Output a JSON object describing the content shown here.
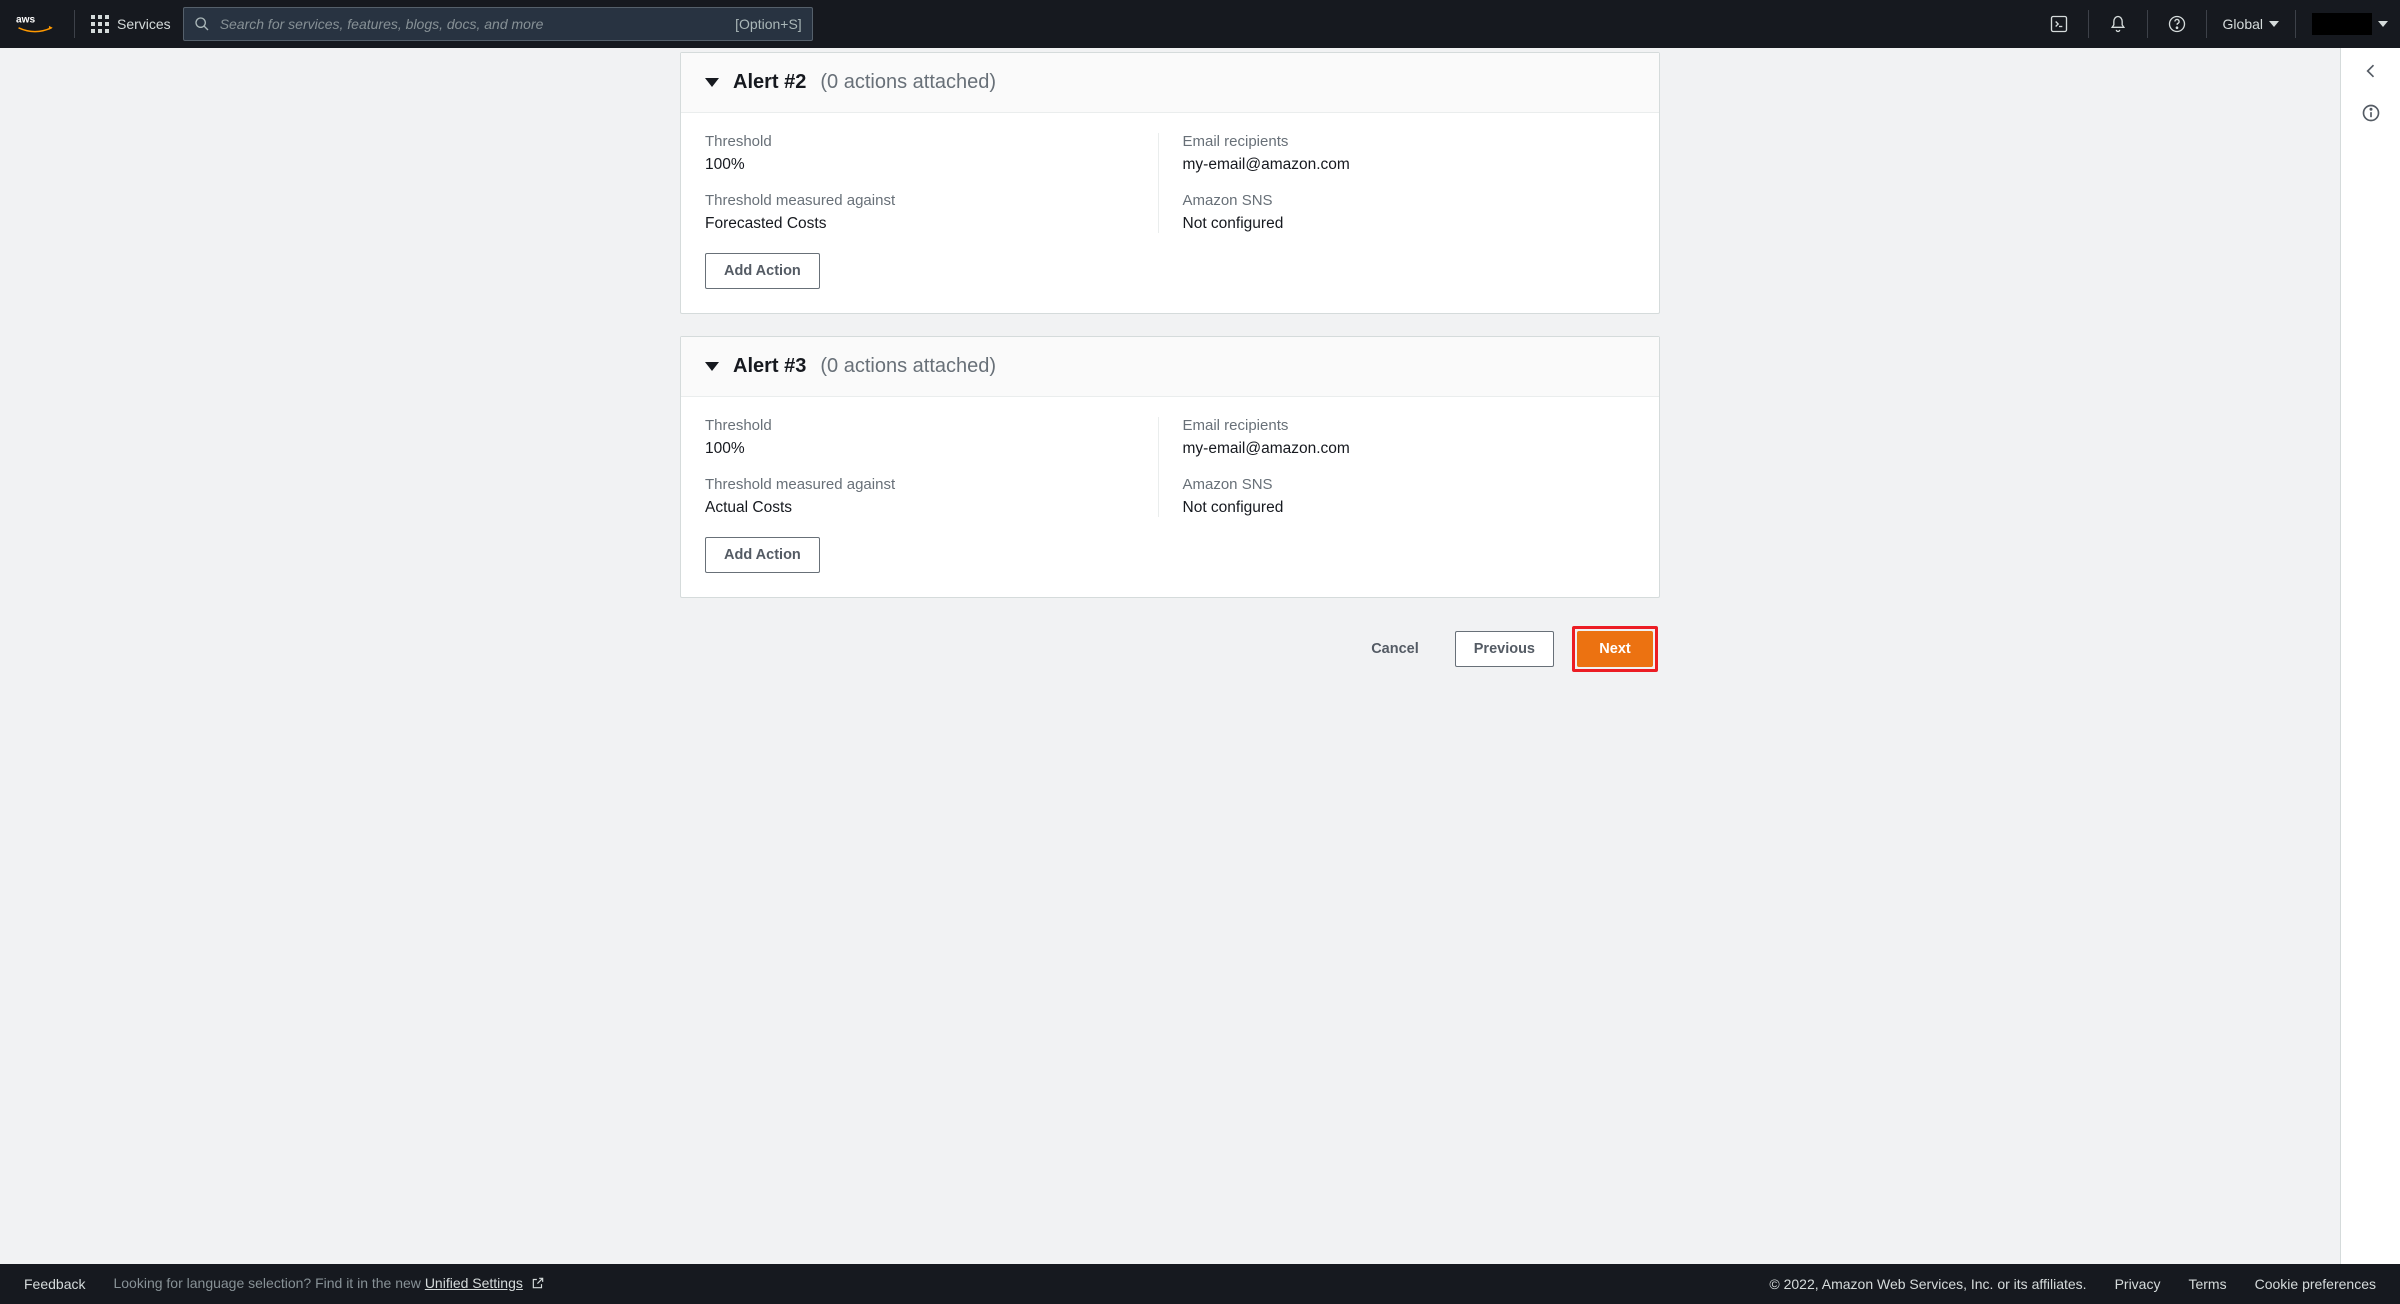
{
  "nav": {
    "services_label": "Services",
    "search_placeholder": "Search for services, features, blogs, docs, and more",
    "search_kbd": "[Option+S]",
    "region_label": "Global"
  },
  "alerts": [
    {
      "title": "Alert #2",
      "subtitle": "(0 actions attached)",
      "threshold_label": "Threshold",
      "threshold_value": "100%",
      "measured_label": "Threshold measured against",
      "measured_value": "Forecasted Costs",
      "email_label": "Email recipients",
      "email_value": "my-email@amazon.com",
      "sns_label": "Amazon SNS",
      "sns_value": "Not configured",
      "add_action_label": "Add Action"
    },
    {
      "title": "Alert #3",
      "subtitle": "(0 actions attached)",
      "threshold_label": "Threshold",
      "threshold_value": "100%",
      "measured_label": "Threshold measured against",
      "measured_value": "Actual Costs",
      "email_label": "Email recipients",
      "email_value": "my-email@amazon.com",
      "sns_label": "Amazon SNS",
      "sns_value": "Not configured",
      "add_action_label": "Add Action"
    }
  ],
  "wizard": {
    "cancel": "Cancel",
    "previous": "Previous",
    "next": "Next"
  },
  "footer": {
    "feedback": "Feedback",
    "lang_prefix": "Looking for language selection? Find it in the new ",
    "lang_link": "Unified Settings",
    "copyright": "© 2022, Amazon Web Services, Inc. or its affiliates.",
    "privacy": "Privacy",
    "terms": "Terms",
    "cookies": "Cookie preferences"
  }
}
